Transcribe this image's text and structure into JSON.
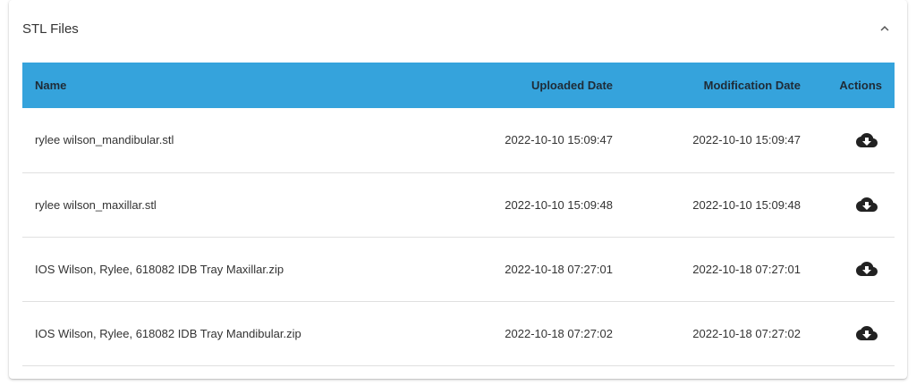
{
  "panel": {
    "title": "STL Files"
  },
  "table": {
    "headers": {
      "name": "Name",
      "uploaded": "Uploaded Date",
      "modified": "Modification Date",
      "actions": "Actions"
    },
    "rows": [
      {
        "name": "rylee wilson_mandibular.stl",
        "uploaded": "2022-10-10 15:09:47",
        "modified": "2022-10-10 15:09:47",
        "action_icon": "cloud-download-icon"
      },
      {
        "name": "rylee wilson_maxillar.stl",
        "uploaded": "2022-10-10 15:09:48",
        "modified": "2022-10-10 15:09:48",
        "action_icon": "cloud-download-icon"
      },
      {
        "name": "IOS Wilson, Rylee, 618082 IDB Tray Maxillar.zip",
        "uploaded": "2022-10-18 07:27:01",
        "modified": "2022-10-18 07:27:01",
        "action_icon": "cloud-download-icon"
      },
      {
        "name": "IOS Wilson, Rylee, 618082 IDB Tray Mandibular.zip",
        "uploaded": "2022-10-18 07:27:02",
        "modified": "2022-10-18 07:27:02",
        "action_icon": "cloud-download-icon"
      }
    ]
  },
  "colors": {
    "header_bg": "#35a3dc",
    "header_text": "#1f2b36",
    "row_divider": "#e0e0e0",
    "icon": "#222222"
  }
}
